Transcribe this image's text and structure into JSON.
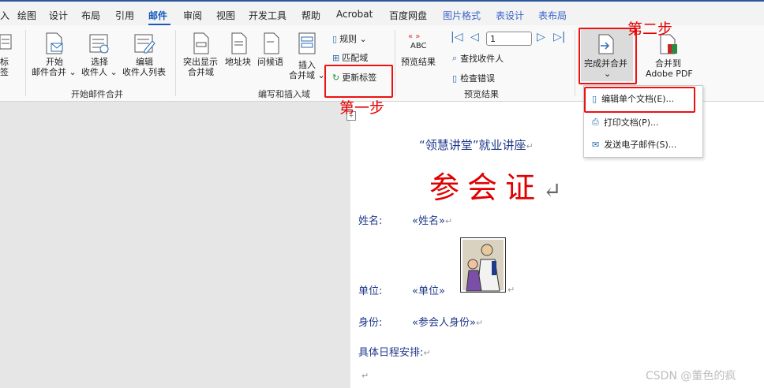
{
  "tabs": [
    "入",
    "绘图",
    "设计",
    "布局",
    "引用",
    "邮件",
    "审阅",
    "视图",
    "开发工具",
    "帮助",
    "Acrobat",
    "百度网盘",
    "图片格式",
    "表设计",
    "表布局"
  ],
  "ribbon": {
    "left_partial": {
      "line1": "标",
      "line2": "签"
    },
    "start_merge": {
      "l1": "开始",
      "l2": "邮件合并 ⌄"
    },
    "select_recipients": {
      "l1": "选择",
      "l2": "收件人 ⌄"
    },
    "edit_recipients": {
      "l1": "编辑",
      "l2": "收件人列表"
    },
    "group_start": "开始邮件合并",
    "highlight": {
      "l1": "突出显示",
      "l2": "合并域"
    },
    "address_block": "地址块",
    "greeting": "问候语",
    "insert_field": {
      "l1": "插入",
      "l2": "合并域 ⌄"
    },
    "rules": "规则 ⌄",
    "match_fields": "匹配域",
    "update_labels": "更新标签",
    "group_write": "编写和插入域",
    "preview_icon_text": "ABC",
    "preview_results": "预览结果",
    "record_value": "1",
    "find_recipient": "查找收件人",
    "check_errors": "检查错误",
    "group_preview": "预览结果",
    "finish_merge": {
      "l1": "完成并合并",
      "l2": "⌄"
    },
    "merge_pdf": {
      "l1": "合并到",
      "l2": "Adobe PDF"
    }
  },
  "annotations": {
    "step1": "第一步",
    "step2": "第二步"
  },
  "dropdown": {
    "items": [
      "编辑单个文档(E)...",
      "打印文档(P)...",
      "发送电子邮件(S)..."
    ]
  },
  "document": {
    "heading": "“领慧讲堂”就业讲座",
    "title": "参会证",
    "return_glyph": "↵",
    "name_label": "姓名:",
    "name_field": "«姓名»",
    "unit_label": "单位:",
    "unit_field": "«单位»",
    "identity_label": "身份:",
    "identity_field": "«参会人身份»",
    "schedule_label": "具体日程安排:"
  },
  "watermark": "CSDN @董色的疯",
  "colors": {
    "accent": "#185abd",
    "annotation": "#e30000",
    "title_red": "#e00000",
    "field_blue": "#1f3a8a"
  }
}
